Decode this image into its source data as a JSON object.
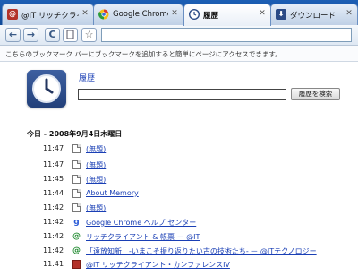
{
  "tabs": [
    {
      "title": "@IT リッチクライアント…",
      "favicon": "itmedia-icon",
      "active": false
    },
    {
      "title": "Google Chrome - …",
      "favicon": "chrome-icon",
      "active": false
    },
    {
      "title": "履歴",
      "favicon": "clock-icon",
      "active": true
    },
    {
      "title": "ダウンロード",
      "favicon": "download-icon",
      "active": false
    }
  ],
  "toolbar": {
    "back_glyph": "←",
    "forward_glyph": "→",
    "reload_glyph": "C",
    "star_glyph": "☆",
    "omnibox_value": ""
  },
  "bookmark_bar": {
    "hint": "こちらのブックマーク バーにブックマークを追加すると簡単にページにアクセスできます。"
  },
  "history": {
    "title": "履歴",
    "search_value": "",
    "search_button": "履歴を検索",
    "date_heading": "今日 - 2008年9月4日木曜日",
    "entries": [
      {
        "time": "11:47",
        "icon": "doc",
        "title": "(無題)"
      },
      {
        "time": "11:47",
        "icon": "doc",
        "title": "(無題)"
      },
      {
        "time": "11:45",
        "icon": "doc",
        "title": "(無題)"
      },
      {
        "time": "11:44",
        "icon": "doc",
        "title": "About Memory"
      },
      {
        "time": "11:42",
        "icon": "doc",
        "title": "(無題)"
      },
      {
        "time": "11:42",
        "icon": "g",
        "title": "Google Chrome ヘルプ センター"
      },
      {
        "time": "11:42",
        "icon": "at",
        "title": "リッチクライアント & 帳票 － @IT"
      },
      {
        "time": "11:42",
        "icon": "at",
        "title": "「遠放知新」-いまこそ振り返りたい古の技術たち- － @ITテクノロジー"
      },
      {
        "time": "11:41",
        "icon": "red",
        "title": "@IT リッチクライアント・カンファレンスIV"
      }
    ]
  },
  "colors": {
    "tabstrip": "#1d5fb5",
    "link": "#1a3fb5",
    "clock_bg": "#2f4f8f"
  }
}
